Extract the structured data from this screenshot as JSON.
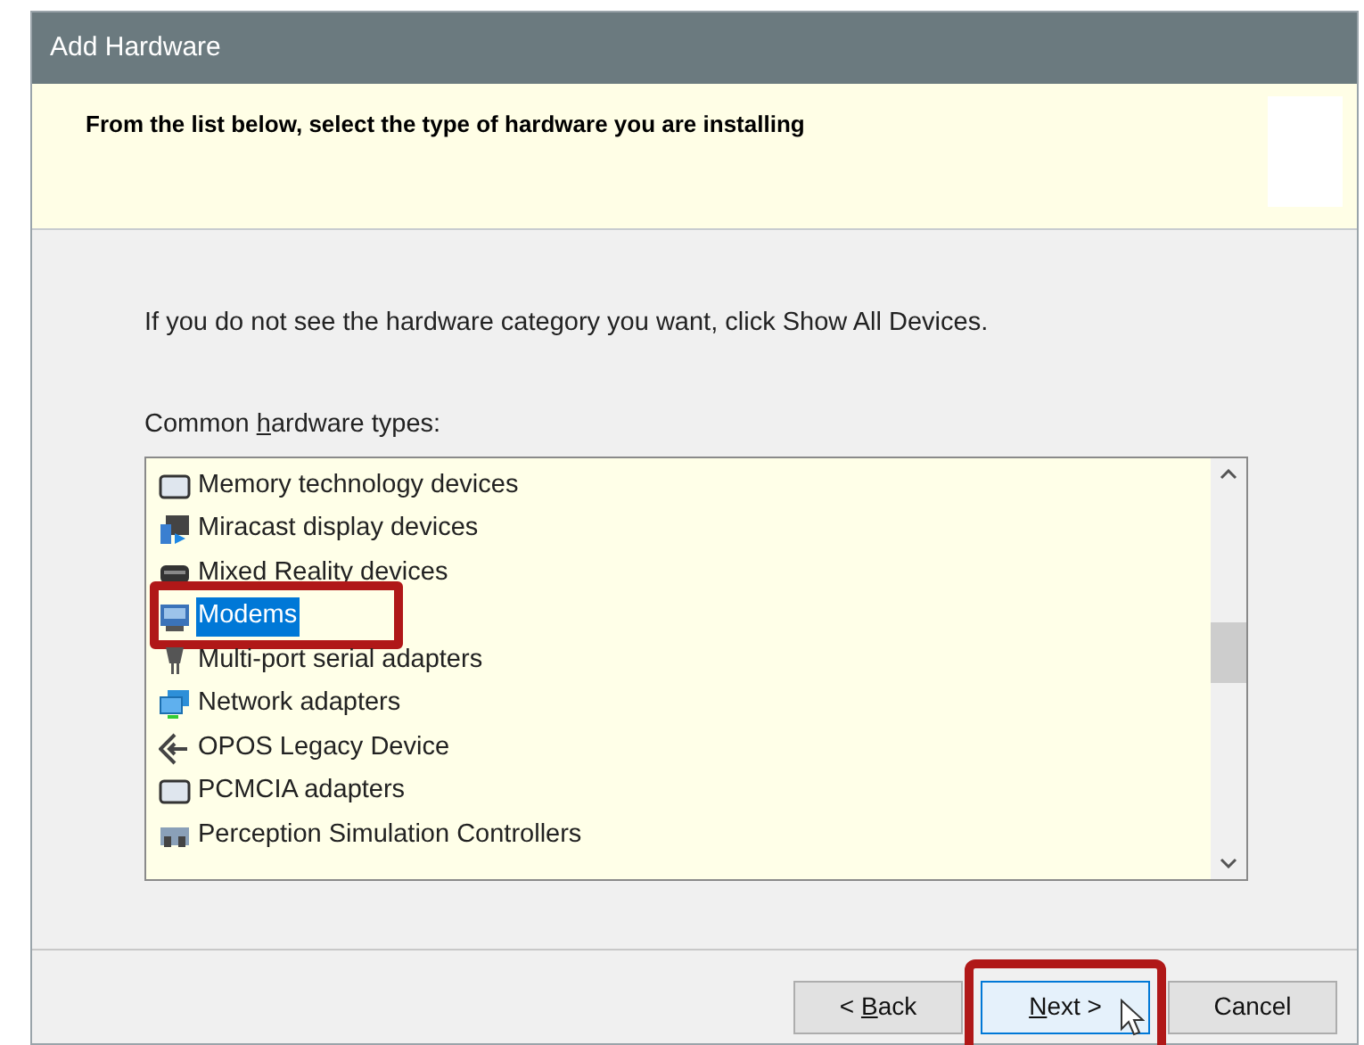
{
  "window": {
    "title": "Add Hardware"
  },
  "header": {
    "heading": "From the list below, select the type of hardware you are installing"
  },
  "instruction": "If you do not see the hardware category you want, click Show All Devices.",
  "list": {
    "label_before": "Common ",
    "label_access_key": "h",
    "label_after": "ardware types:",
    "items": [
      {
        "label": "Memory technology devices",
        "selected": false,
        "highlighted": false
      },
      {
        "label": "Miracast display devices",
        "selected": false,
        "highlighted": false
      },
      {
        "label": "Mixed Reality devices",
        "selected": false,
        "highlighted": false
      },
      {
        "label": "Modems",
        "selected": true,
        "highlighted": true
      },
      {
        "label": "Multi-port serial adapters",
        "selected": false,
        "highlighted": false
      },
      {
        "label": "Network adapters",
        "selected": false,
        "highlighted": false
      },
      {
        "label": "OPOS Legacy Device",
        "selected": false,
        "highlighted": false
      },
      {
        "label": "PCMCIA adapters",
        "selected": false,
        "highlighted": false
      },
      {
        "label": "Perception Simulation Controllers",
        "selected": false,
        "highlighted": false
      }
    ]
  },
  "buttons": [
    {
      "before": "< ",
      "access_key": "B",
      "after": "ack",
      "focused": false,
      "highlighted": false
    },
    {
      "access_key": "N",
      "after": "ext >",
      "focused": true,
      "highlighted": true
    },
    {
      "after": "Cancel",
      "focused": false,
      "highlighted": false
    }
  ]
}
